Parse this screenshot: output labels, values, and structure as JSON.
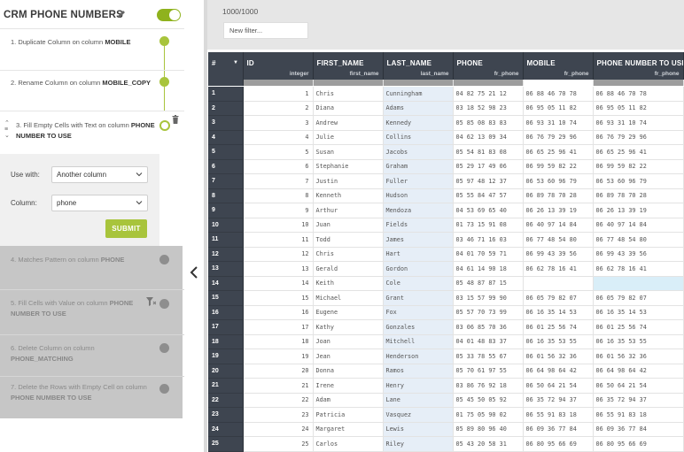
{
  "left_panel": {
    "title": "CRM PHONE NUMBERS",
    "toggle_on": true,
    "steps": [
      {
        "prefix": "1. Duplicate Column on column ",
        "bold": "MOBILE",
        "state": "done"
      },
      {
        "prefix": "2. Rename Column on column ",
        "bold": "MOBILE_COPY",
        "state": "done"
      },
      {
        "prefix": "3. Fill Empty Cells with Text on column ",
        "bold": "PHONE NUMBER TO USE",
        "state": "active"
      },
      {
        "prefix": "4. Matches Pattern on column ",
        "bold": "PHONE",
        "state": "disabled"
      },
      {
        "prefix": "5. Fill Cells with Value on column ",
        "bold": "PHONE NUMBER TO USE",
        "state": "disabled"
      },
      {
        "prefix": "6. Delete Column on column ",
        "bold": "PHONE_MATCHING",
        "state": "disabled"
      },
      {
        "prefix": "7. Delete the Rows with Empty Cell on column ",
        "bold": "PHONE NUMBER TO USE",
        "state": "disabled"
      }
    ],
    "form": {
      "use_with_label": "Use with:",
      "use_with_value": "Another column",
      "column_label": "Column:",
      "column_value": "phone",
      "submit_label": "SUBMIT"
    },
    "colors": {
      "accent": "#a8c43c",
      "disabled_bg": "#c6c6c6",
      "header_dark": "#3e4550"
    }
  },
  "grid": {
    "row_count_text": "1000/1000",
    "filter_placeholder": "New filter...",
    "index_header": "#",
    "columns": [
      {
        "name": "ID",
        "type": "integer"
      },
      {
        "name": "FIRST_NAME",
        "type": "first_name"
      },
      {
        "name": "LAST_NAME",
        "type": "last_name"
      },
      {
        "name": "PHONE",
        "type": "fr_phone"
      },
      {
        "name": "MOBILE",
        "type": "fr_phone"
      },
      {
        "name": "PHONE NUMBER TO USE",
        "type": "fr_phone"
      }
    ],
    "rows": [
      [
        "1",
        "1",
        "Chris",
        "Cunningham",
        "04 82 75 21 12",
        "06 88 46 70 78",
        "06 88 46 70 78"
      ],
      [
        "2",
        "2",
        "Diana",
        "Adams",
        "03 18 52 98 23",
        "06 95 05 11 82",
        "06 95 05 11 82"
      ],
      [
        "3",
        "3",
        "Andrew",
        "Kennedy",
        "05 85 08 83 83",
        "06 93 31 10 74",
        "06 93 31 10 74"
      ],
      [
        "4",
        "4",
        "Julie",
        "Collins",
        "04 62 13 09 34",
        "06 76 79 29 96",
        "06 76 79 29 96"
      ],
      [
        "5",
        "5",
        "Susan",
        "Jacobs",
        "05 54 81 83 08",
        "06 65 25 96 41",
        "06 65 25 96 41"
      ],
      [
        "6",
        "6",
        "Stephanie",
        "Graham",
        "05 29 17 49 06",
        "06 99 59 82 22",
        "06 99 59 82 22"
      ],
      [
        "7",
        "7",
        "Justin",
        "Fuller",
        "05 97 48 12 37",
        "06 53 60 96 79",
        "06 53 60 96 79"
      ],
      [
        "8",
        "8",
        "Kenneth",
        "Hudson",
        "05 55 84 47 57",
        "06 89 78 70 28",
        "06 89 78 70 28"
      ],
      [
        "9",
        "9",
        "Arthur",
        "Mendoza",
        "04 53 69 65 40",
        "06 26 13 39 19",
        "06 26 13 39 19"
      ],
      [
        "10",
        "10",
        "Juan",
        "Fields",
        "01 73 15 91 08",
        "06 40 97 14 84",
        "06 40 97 14 84"
      ],
      [
        "11",
        "11",
        "Todd",
        "James",
        "03 46 71 16 03",
        "06 77 48 54 80",
        "06 77 48 54 80"
      ],
      [
        "12",
        "12",
        "Chris",
        "Hart",
        "04 01 70 59 71",
        "06 99 43 39 56",
        "06 99 43 39 56"
      ],
      [
        "13",
        "13",
        "Gerald",
        "Gordon",
        "04 61 14 90 18",
        "06 62 78 16 41",
        "06 62 78 16 41"
      ],
      [
        "14",
        "14",
        "Keith",
        "Cole",
        "05 48 87 87 15",
        "",
        ""
      ],
      [
        "15",
        "15",
        "Michael",
        "Grant",
        "03 15 57 99 90",
        "06 05 79 82 07",
        "06 05 79 82 07"
      ],
      [
        "16",
        "16",
        "Eugene",
        "Fox",
        "05 57 70 73 99",
        "06 16 35 14 53",
        "06 16 35 14 53"
      ],
      [
        "17",
        "17",
        "Kathy",
        "Gonzales",
        "03 06 85 70 36",
        "06 01 25 56 74",
        "06 01 25 56 74"
      ],
      [
        "18",
        "18",
        "Joan",
        "Mitchell",
        "04 01 48 83 37",
        "06 16 35 53 55",
        "06 16 35 53 55"
      ],
      [
        "19",
        "19",
        "Jean",
        "Henderson",
        "05 33 78 55 67",
        "06 01 56 32 36",
        "06 01 56 32 36"
      ],
      [
        "20",
        "20",
        "Donna",
        "Ramos",
        "05 70 61 97 55",
        "06 64 98 64 42",
        "06 64 98 64 42"
      ],
      [
        "21",
        "21",
        "Irene",
        "Henry",
        "03 86 76 92 18",
        "06 50 64 21 54",
        "06 50 64 21 54"
      ],
      [
        "22",
        "22",
        "Adam",
        "Lane",
        "05 45 50 05 92",
        "06 35 72 94 37",
        "06 35 72 94 37"
      ],
      [
        "23",
        "23",
        "Patricia",
        "Vasquez",
        "01 75 05 90 02",
        "06 55 91 83 18",
        "06 55 91 83 18"
      ],
      [
        "24",
        "24",
        "Margaret",
        "Lewis",
        "05 89 80 96 40",
        "06 09 36 77 84",
        "06 09 36 77 84"
      ],
      [
        "25",
        "25",
        "Carlos",
        "Riley",
        "05 43 20 58 31",
        "06 80 95 66 69",
        "06 80 95 66 69"
      ]
    ]
  }
}
